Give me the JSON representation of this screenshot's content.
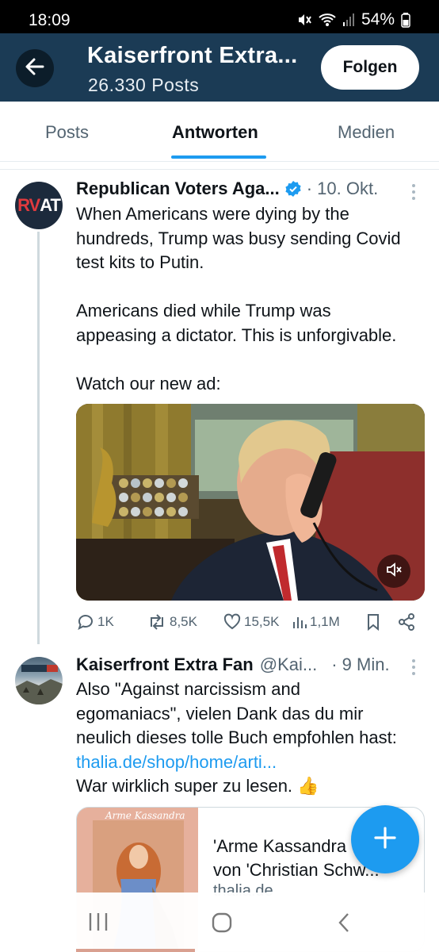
{
  "status_bar": {
    "time": "18:09",
    "battery": "54%"
  },
  "header": {
    "title": "Kaiserfront Extra...",
    "posts_count": "26.330 Posts",
    "follow_label": "Folgen"
  },
  "tabs": [
    {
      "label": "Posts",
      "active": false
    },
    {
      "label": "Antworten",
      "active": true
    },
    {
      "label": "Medien",
      "active": false
    }
  ],
  "tweets": [
    {
      "avatar_text_red": "RV",
      "avatar_text_white": "AT",
      "name": "Republican Voters Aga...",
      "verified": true,
      "meta": "· 10. Okt.",
      "body_lines": [
        "When Americans were dying by the",
        "hundreds, Trump was busy sending Covid",
        "test kits to Putin.",
        "",
        "Americans died while Trump was",
        "appeasing a dictator. This is unforgivable.",
        "",
        "Watch our new ad:"
      ],
      "actions": {
        "replies": "1K",
        "reposts": "8,5K",
        "likes": "15,5K",
        "views": "1,1M"
      }
    },
    {
      "name": "Kaiserfront Extra Fan",
      "handle": "@Kai...",
      "meta": "· 9 Min.",
      "body_lines": [
        "Also \"Against narcissism and",
        "egomaniacs\", vielen Dank das du mir",
        "neulich dieses tolle Buch empfohlen hast:"
      ],
      "link_text": "thalia.de/shop/home/arti...",
      "last_line": "War wirklich super zu lesen. 👍",
      "card": {
        "image_title": "Arme Kassandra",
        "title_line1": "'Arme Kassandra",
        "title_line2": "von 'Christian Schw...",
        "domain": "thalia.de"
      }
    }
  ],
  "colors": {
    "header_bg": "#1b3b55",
    "accent": "#1d9bf0",
    "muted_text": "#536471"
  },
  "icons": {
    "back": "arrow-left-icon",
    "verified": "verified-badge-icon",
    "reply": "reply-icon",
    "repost": "repost-icon",
    "like": "heart-icon",
    "views": "views-icon",
    "bookmark": "bookmark-icon",
    "share": "share-icon",
    "compose": "plus-icon",
    "mute": "muted-speaker-icon"
  }
}
